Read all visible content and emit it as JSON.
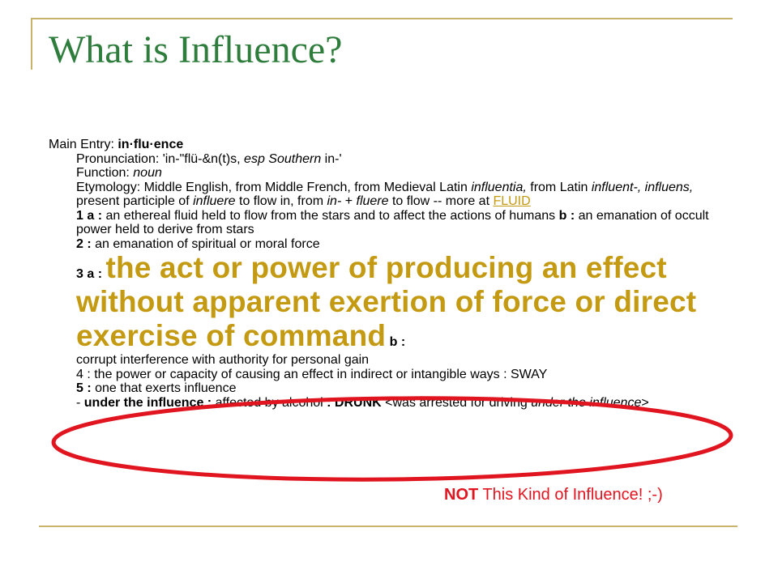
{
  "slide": {
    "title": "What is Influence?",
    "main_entry_label": "Main Entry: ",
    "main_entry_word": "in·flu·ence",
    "pronunciation_prefix": "Pronunciation: 'in-\"flü-&n(t)s, ",
    "pronunciation_esp": "esp Southern",
    "pronunciation_suffix": " in-'",
    "function_label": "Function: ",
    "function_value": "noun",
    "etym_1": "Etymology: Middle English, from Middle French, from Medieval Latin ",
    "etym_influentia": "influentia,",
    "etym_2": " from Latin ",
    "etym_influent": "influent-, influens,",
    "etym_3": " present participle of ",
    "etym_influere": "influere",
    "etym_4": " to flow in, from ",
    "etym_in": "in-",
    "etym_5": " + ",
    "etym_fluere": "fluere",
    "etym_6": " to flow -- more at ",
    "etym_link": "FLUID",
    "def1a_label": "1 a : ",
    "def1a_text": "an ethereal fluid held to flow from the stars and to affect the actions of humans ",
    "def1b_label": "b : ",
    "def1b_text": "an emanation of occult power held to derive from stars",
    "def2_label": "2 : ",
    "def2_text": "an emanation of spiritual or moral force",
    "def3a_label": "3 a : ",
    "def3a_text": "the act or power of producing an effect without apparent exertion of force or direct exercise of command",
    "def3b_label": " b : ",
    "def3b_text": "corrupt interference with authority for personal gain",
    "def4_text": "4 : the power or capacity of causing an effect in indirect or intangible ways : SWAY",
    "def5_label": "5 : ",
    "def5_text": "one that exerts influence",
    "phrase_dash": "- ",
    "phrase_label": "under the influence : ",
    "phrase_text": "affected by alcohol ",
    "phrase_colon": ": DRUNK",
    "phrase_ex_1": " <was arrested for driving ",
    "phrase_ex_italic": "under the influence",
    "phrase_ex_2": ">",
    "note_bold": "NOT",
    "note_text": " This Kind of Influence! ;-)"
  },
  "colors": {
    "title": "#2e7d3c",
    "accent": "#c49a12",
    "rule": "#c9b26c",
    "circle": "#e01520"
  }
}
